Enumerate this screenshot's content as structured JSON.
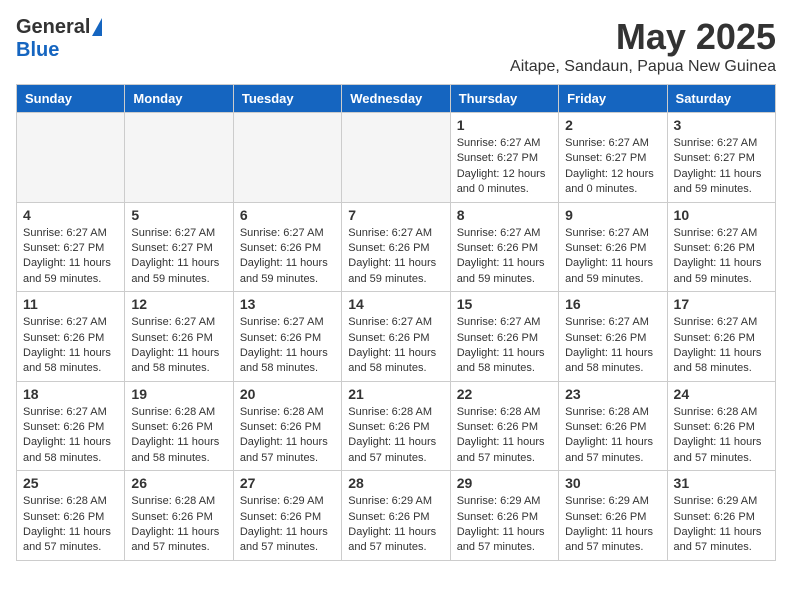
{
  "logo": {
    "general": "General",
    "blue": "Blue"
  },
  "header": {
    "month": "May 2025",
    "location": "Aitape, Sandaun, Papua New Guinea"
  },
  "weekdays": [
    "Sunday",
    "Monday",
    "Tuesday",
    "Wednesday",
    "Thursday",
    "Friday",
    "Saturday"
  ],
  "weeks": [
    [
      {
        "day": "",
        "empty": true
      },
      {
        "day": "",
        "empty": true
      },
      {
        "day": "",
        "empty": true
      },
      {
        "day": "",
        "empty": true
      },
      {
        "day": "1",
        "sunrise": "6:27 AM",
        "sunset": "6:27 PM",
        "daylight": "12 hours and 0 minutes."
      },
      {
        "day": "2",
        "sunrise": "6:27 AM",
        "sunset": "6:27 PM",
        "daylight": "12 hours and 0 minutes."
      },
      {
        "day": "3",
        "sunrise": "6:27 AM",
        "sunset": "6:27 PM",
        "daylight": "11 hours and 59 minutes."
      }
    ],
    [
      {
        "day": "4",
        "sunrise": "6:27 AM",
        "sunset": "6:27 PM",
        "daylight": "11 hours and 59 minutes."
      },
      {
        "day": "5",
        "sunrise": "6:27 AM",
        "sunset": "6:27 PM",
        "daylight": "11 hours and 59 minutes."
      },
      {
        "day": "6",
        "sunrise": "6:27 AM",
        "sunset": "6:26 PM",
        "daylight": "11 hours and 59 minutes."
      },
      {
        "day": "7",
        "sunrise": "6:27 AM",
        "sunset": "6:26 PM",
        "daylight": "11 hours and 59 minutes."
      },
      {
        "day": "8",
        "sunrise": "6:27 AM",
        "sunset": "6:26 PM",
        "daylight": "11 hours and 59 minutes."
      },
      {
        "day": "9",
        "sunrise": "6:27 AM",
        "sunset": "6:26 PM",
        "daylight": "11 hours and 59 minutes."
      },
      {
        "day": "10",
        "sunrise": "6:27 AM",
        "sunset": "6:26 PM",
        "daylight": "11 hours and 59 minutes."
      }
    ],
    [
      {
        "day": "11",
        "sunrise": "6:27 AM",
        "sunset": "6:26 PM",
        "daylight": "11 hours and 58 minutes."
      },
      {
        "day": "12",
        "sunrise": "6:27 AM",
        "sunset": "6:26 PM",
        "daylight": "11 hours and 58 minutes."
      },
      {
        "day": "13",
        "sunrise": "6:27 AM",
        "sunset": "6:26 PM",
        "daylight": "11 hours and 58 minutes."
      },
      {
        "day": "14",
        "sunrise": "6:27 AM",
        "sunset": "6:26 PM",
        "daylight": "11 hours and 58 minutes."
      },
      {
        "day": "15",
        "sunrise": "6:27 AM",
        "sunset": "6:26 PM",
        "daylight": "11 hours and 58 minutes."
      },
      {
        "day": "16",
        "sunrise": "6:27 AM",
        "sunset": "6:26 PM",
        "daylight": "11 hours and 58 minutes."
      },
      {
        "day": "17",
        "sunrise": "6:27 AM",
        "sunset": "6:26 PM",
        "daylight": "11 hours and 58 minutes."
      }
    ],
    [
      {
        "day": "18",
        "sunrise": "6:27 AM",
        "sunset": "6:26 PM",
        "daylight": "11 hours and 58 minutes."
      },
      {
        "day": "19",
        "sunrise": "6:28 AM",
        "sunset": "6:26 PM",
        "daylight": "11 hours and 58 minutes."
      },
      {
        "day": "20",
        "sunrise": "6:28 AM",
        "sunset": "6:26 PM",
        "daylight": "11 hours and 57 minutes."
      },
      {
        "day": "21",
        "sunrise": "6:28 AM",
        "sunset": "6:26 PM",
        "daylight": "11 hours and 57 minutes."
      },
      {
        "day": "22",
        "sunrise": "6:28 AM",
        "sunset": "6:26 PM",
        "daylight": "11 hours and 57 minutes."
      },
      {
        "day": "23",
        "sunrise": "6:28 AM",
        "sunset": "6:26 PM",
        "daylight": "11 hours and 57 minutes."
      },
      {
        "day": "24",
        "sunrise": "6:28 AM",
        "sunset": "6:26 PM",
        "daylight": "11 hours and 57 minutes."
      }
    ],
    [
      {
        "day": "25",
        "sunrise": "6:28 AM",
        "sunset": "6:26 PM",
        "daylight": "11 hours and 57 minutes."
      },
      {
        "day": "26",
        "sunrise": "6:28 AM",
        "sunset": "6:26 PM",
        "daylight": "11 hours and 57 minutes."
      },
      {
        "day": "27",
        "sunrise": "6:29 AM",
        "sunset": "6:26 PM",
        "daylight": "11 hours and 57 minutes."
      },
      {
        "day": "28",
        "sunrise": "6:29 AM",
        "sunset": "6:26 PM",
        "daylight": "11 hours and 57 minutes."
      },
      {
        "day": "29",
        "sunrise": "6:29 AM",
        "sunset": "6:26 PM",
        "daylight": "11 hours and 57 minutes."
      },
      {
        "day": "30",
        "sunrise": "6:29 AM",
        "sunset": "6:26 PM",
        "daylight": "11 hours and 57 minutes."
      },
      {
        "day": "31",
        "sunrise": "6:29 AM",
        "sunset": "6:26 PM",
        "daylight": "11 hours and 57 minutes."
      }
    ]
  ],
  "labels": {
    "sunrise": "Sunrise:",
    "sunset": "Sunset:",
    "daylight": "Daylight:"
  }
}
